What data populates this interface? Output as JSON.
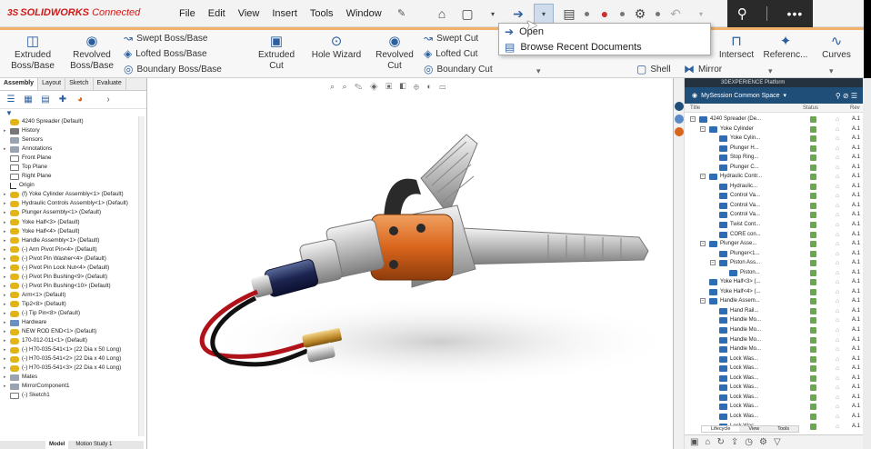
{
  "app": {
    "logo_mark": "3S",
    "logo_brand": "SOLIDWORKS",
    "logo_suffix": "Connected"
  },
  "menu": [
    "File",
    "Edit",
    "View",
    "Insert",
    "Tools",
    "Window"
  ],
  "quick_access": {
    "open_dropdown": {
      "items": [
        "Open",
        "Browse Recent Documents"
      ]
    }
  },
  "ribbon": {
    "extruded_boss": "Extruded\nBoss/Base",
    "revolved_boss": "Revolved\nBoss/Base",
    "swept_boss": "Swept Boss/Base",
    "lofted_boss": "Lofted Boss/Base",
    "boundary_boss": "Boundary Boss/Base",
    "extruded_cut": "Extruded\nCut",
    "hole_wizard": "Hole Wizard",
    "revolved_cut": "Revolved\nCut",
    "swept_cut": "Swept Cut",
    "lofted_cut": "Lofted Cut",
    "boundary_cut": "Boundary Cut",
    "intersect_partial": "Intersect",
    "reference": "Referenc...",
    "curves": "Curves",
    "shell": "Shell",
    "mirror": "Mirror"
  },
  "feature_manager": {
    "tabs": [
      "Assembly",
      "Layout",
      "Sketch",
      "Evaluate"
    ],
    "active_tab": "Assembly",
    "tree": [
      {
        "label": "4240 Spreader (Default)",
        "icon": "part",
        "arrow": ""
      },
      {
        "label": "History",
        "icon": "hist",
        "arrow": "▸"
      },
      {
        "label": "Sensors",
        "icon": "sensor",
        "arrow": ""
      },
      {
        "label": "Annotations",
        "icon": "sensor",
        "arrow": "▸"
      },
      {
        "label": "Front Plane",
        "icon": "plane",
        "arrow": ""
      },
      {
        "label": "Top Plane",
        "icon": "plane",
        "arrow": ""
      },
      {
        "label": "Right Plane",
        "icon": "plane",
        "arrow": ""
      },
      {
        "label": "Origin",
        "icon": "origin",
        "arrow": ""
      },
      {
        "label": "(f) Yoke Cylinder Assembly<1> (Default)",
        "icon": "part",
        "arrow": "▸"
      },
      {
        "label": "Hydraulic Controls Assembly<1> (Default)",
        "icon": "part",
        "arrow": "▸"
      },
      {
        "label": "Plunger Assembly<1> (Default)",
        "icon": "part",
        "arrow": "▸"
      },
      {
        "label": "Yoke Half<3> (Default)",
        "icon": "part",
        "arrow": "▸"
      },
      {
        "label": "Yoke Half<4> (Default)",
        "icon": "part",
        "arrow": "▸"
      },
      {
        "label": "Handle Assembly<1> (Default)",
        "icon": "part",
        "arrow": "▸"
      },
      {
        "label": "(-) Arm Pivot Pin<4> (Default)",
        "icon": "part",
        "arrow": "▸"
      },
      {
        "label": "(-) Pivot Pin Washer<4> (Default)",
        "icon": "part",
        "arrow": "▸"
      },
      {
        "label": "(-) Pivot Pin Lock Nut<4> (Default)",
        "icon": "part",
        "arrow": "▸"
      },
      {
        "label": "(-) Pivot Pin Bushing<9> (Default)",
        "icon": "part",
        "arrow": "▸"
      },
      {
        "label": "(-) Pivot Pin Bushing<10> (Default)",
        "icon": "part",
        "arrow": "▸"
      },
      {
        "label": "Arm<1> (Default)",
        "icon": "part",
        "arrow": "▸"
      },
      {
        "label": "Tip2<8> (Default)",
        "icon": "part",
        "arrow": "▸"
      },
      {
        "label": "(-) Tip Pin<8> (Default)",
        "icon": "part",
        "arrow": "▸"
      },
      {
        "label": "Hardware",
        "icon": "folder",
        "arrow": "▸"
      },
      {
        "label": "NEW ROD END<1> (Default)",
        "icon": "part",
        "arrow": "▸"
      },
      {
        "label": "170-012-011<1> (Default)",
        "icon": "part",
        "arrow": "▸"
      },
      {
        "label": "(-) H70-035-541<1> (22 Dia x 50 Long)",
        "icon": "part",
        "arrow": "▸"
      },
      {
        "label": "(-) H70-035-541<2> (22 Dia x 40 Long)",
        "icon": "part",
        "arrow": "▸"
      },
      {
        "label": "(-) H70-035-541<3> (22 Dia x 40 Long)",
        "icon": "part",
        "arrow": "▸"
      },
      {
        "label": "Mates",
        "icon": "sensor",
        "arrow": "▸"
      },
      {
        "label": "MirrorComponent1",
        "icon": "sensor",
        "arrow": "▸"
      },
      {
        "label": "(-) Sketch1",
        "icon": "plane",
        "arrow": ""
      }
    ],
    "bottom_tabs": [
      "Model",
      "Motion Study 1"
    ]
  },
  "platform_panel": {
    "header": "3DEXPERIENCE Platform",
    "session": "MySession Common Space",
    "columns": {
      "title": "Title",
      "status": "Status",
      "rev": "Rev"
    },
    "rows": [
      {
        "label": "4240 Spreader (De...",
        "indent": 0,
        "toggle": "−"
      },
      {
        "label": "Yoke Cylinder",
        "indent": 1,
        "toggle": "−"
      },
      {
        "label": "Yoke Cylin...",
        "indent": 2,
        "toggle": ""
      },
      {
        "label": "Plunger H...",
        "indent": 2,
        "toggle": ""
      },
      {
        "label": "Stop Ring...",
        "indent": 2,
        "toggle": ""
      },
      {
        "label": "Plunger C...",
        "indent": 2,
        "toggle": ""
      },
      {
        "label": "Hydraulic Contr...",
        "indent": 1,
        "toggle": "−"
      },
      {
        "label": "Hydraulic...",
        "indent": 2,
        "toggle": ""
      },
      {
        "label": "Control Va...",
        "indent": 2,
        "toggle": ""
      },
      {
        "label": "Control Va...",
        "indent": 2,
        "toggle": ""
      },
      {
        "label": "Control Va...",
        "indent": 2,
        "toggle": ""
      },
      {
        "label": "Twist Cont...",
        "indent": 2,
        "toggle": ""
      },
      {
        "label": "CORE con...",
        "indent": 2,
        "toggle": ""
      },
      {
        "label": "Plunger Asse...",
        "indent": 1,
        "toggle": "−"
      },
      {
        "label": "Plunger<1...",
        "indent": 2,
        "toggle": ""
      },
      {
        "label": "Piston Ass...",
        "indent": 2,
        "toggle": "−"
      },
      {
        "label": "Piston...",
        "indent": 3,
        "toggle": ""
      },
      {
        "label": "Yoke Half<3> (...",
        "indent": 1,
        "toggle": ""
      },
      {
        "label": "Yoke Half<4> (...",
        "indent": 1,
        "toggle": ""
      },
      {
        "label": "Handle Assem...",
        "indent": 1,
        "toggle": "−"
      },
      {
        "label": "Hand Rail...",
        "indent": 2,
        "toggle": ""
      },
      {
        "label": "Handle Mo...",
        "indent": 2,
        "toggle": ""
      },
      {
        "label": "Handle Mo...",
        "indent": 2,
        "toggle": ""
      },
      {
        "label": "Handle Mo...",
        "indent": 2,
        "toggle": ""
      },
      {
        "label": "Handle Mo...",
        "indent": 2,
        "toggle": ""
      },
      {
        "label": "Lock Was...",
        "indent": 2,
        "toggle": ""
      },
      {
        "label": "Lock Was...",
        "indent": 2,
        "toggle": ""
      },
      {
        "label": "Lock Was...",
        "indent": 2,
        "toggle": ""
      },
      {
        "label": "Lock Was...",
        "indent": 2,
        "toggle": ""
      },
      {
        "label": "Lock Was...",
        "indent": 2,
        "toggle": ""
      },
      {
        "label": "Lock Was...",
        "indent": 2,
        "toggle": ""
      },
      {
        "label": "Lock Was...",
        "indent": 2,
        "toggle": ""
      },
      {
        "label": "Lock Was...",
        "indent": 2,
        "toggle": ""
      }
    ],
    "rev_value": "A.1",
    "bottom_tabs": [
      "Lifecycle",
      "View",
      "Tools"
    ]
  },
  "colors": {
    "brand_red": "#d11a1a",
    "ribbon_accent": "#f0b26a",
    "session_bar": "#1f4e79",
    "status_green": "#6aa84f",
    "tool_orange": "#d9651c"
  }
}
